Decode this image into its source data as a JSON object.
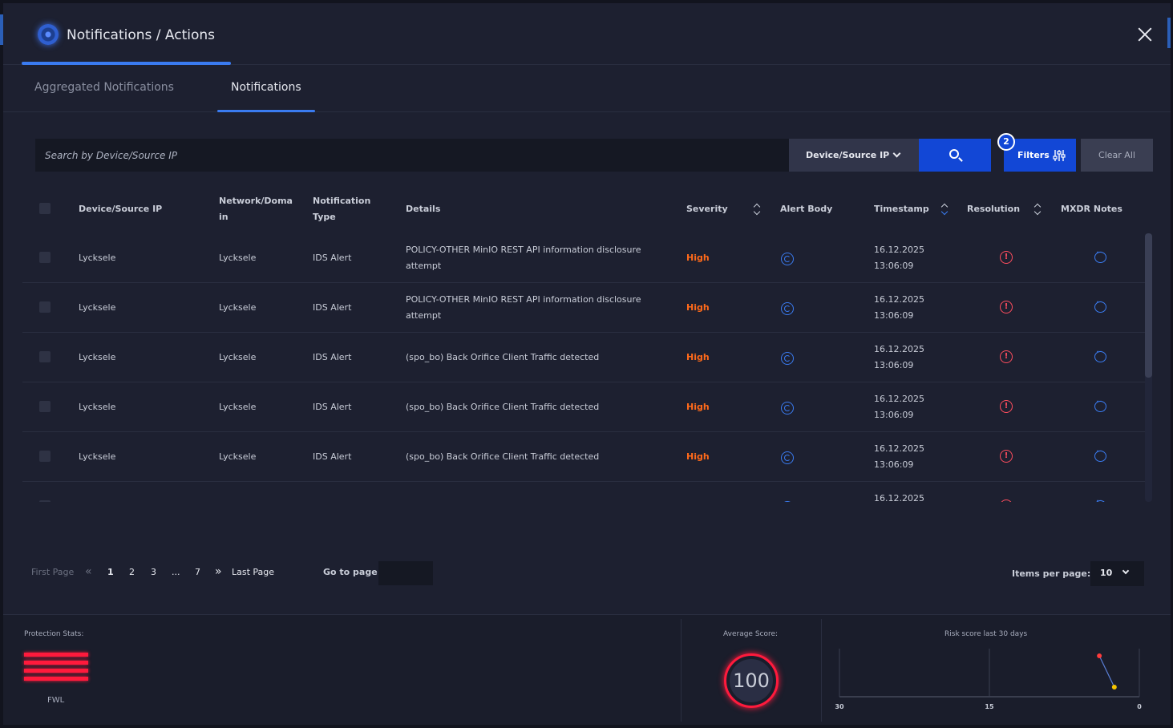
{
  "header": {
    "title": "Notifications / Actions"
  },
  "tabs": [
    {
      "label": "Aggregated Notifications"
    },
    {
      "label": "Notifications"
    }
  ],
  "search": {
    "placeholder": "Search by Device/Source IP",
    "field_select": "Device/Source IP",
    "filters_label": "Filters",
    "filters_count": "2",
    "clear_label": "Clear All"
  },
  "table": {
    "columns": [
      "Device/Source IP",
      "Network/Domain",
      "Notification Type",
      "Details",
      "Severity",
      "Alert Body",
      "Timestamp",
      "Resolution",
      "MXDR Notes"
    ],
    "columns_display": {
      "network": "Network/Doma",
      "network2": "in",
      "type": "Notification",
      "type2": "Type"
    },
    "rows": [
      {
        "device": "Lycksele",
        "network": "Lycksele",
        "type": "IDS Alert",
        "details1": "POLICY-OTHER MinIO REST API information disclosure",
        "details2": "attempt",
        "severity": "High",
        "date": "16.12.2025",
        "time": "13:06:09"
      },
      {
        "device": "Lycksele",
        "network": "Lycksele",
        "type": "IDS Alert",
        "details1": "POLICY-OTHER MinIO REST API information disclosure",
        "details2": "attempt",
        "severity": "High",
        "date": "16.12.2025",
        "time": "13:06:09"
      },
      {
        "device": "Lycksele",
        "network": "Lycksele",
        "type": "IDS Alert",
        "details1": "(spo_bo) Back Orifice Client Traffic detected",
        "details2": "",
        "severity": "High",
        "date": "16.12.2025",
        "time": "13:06:09"
      },
      {
        "device": "Lycksele",
        "network": "Lycksele",
        "type": "IDS Alert",
        "details1": "(spo_bo) Back Orifice Client Traffic detected",
        "details2": "",
        "severity": "High",
        "date": "16.12.2025",
        "time": "13:06:09"
      },
      {
        "device": "Lycksele",
        "network": "Lycksele",
        "type": "IDS Alert",
        "details1": "(spo_bo) Back Orifice Client Traffic detected",
        "details2": "",
        "severity": "High",
        "date": "16.12.2025",
        "time": "13:06:09"
      },
      {
        "device": "",
        "network": "",
        "type": "",
        "details1": "",
        "details2": "",
        "severity": "",
        "date": "16.12.2025",
        "time": ""
      }
    ]
  },
  "pagination": {
    "first": "First Page",
    "pages": [
      "1",
      "2",
      "3",
      "...",
      "7"
    ],
    "last": "Last Page",
    "goto_label": "Go to page:",
    "items_label": "Items per page:",
    "items_value": "10",
    "current_page": 1
  },
  "stats": {
    "protection_label": "Protection Stats:",
    "fwl_label": "FWL",
    "avg_label": "Average Score:",
    "avg_value": "100",
    "risk_label": "Risk score last 30 days"
  },
  "chart_data": {
    "type": "line",
    "title": "Risk score last 30 days",
    "x_ticks": [
      "30",
      "15",
      "0"
    ],
    "points": [
      {
        "x": 4,
        "y": 0.85
      },
      {
        "x": 2.5,
        "y": 0.2
      }
    ],
    "colors": {
      "first": "#ff3b3b",
      "second": "#f5c400",
      "line": "#5a7fd6"
    }
  },
  "colors": {
    "accent": "#1247d6",
    "severity_high": "#ff6a1a",
    "danger": "#ff1a3c"
  }
}
